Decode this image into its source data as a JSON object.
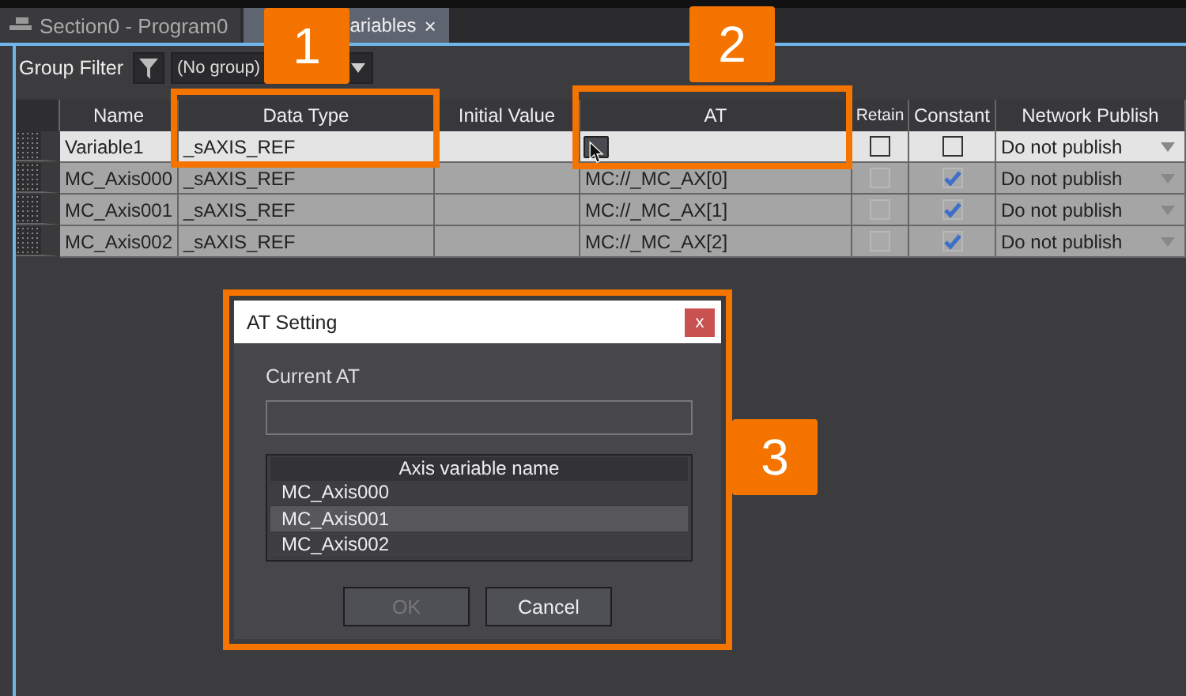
{
  "tabs": [
    {
      "label": "Section0 - Program0",
      "selected": false
    },
    {
      "label": "ariables",
      "selected": true,
      "close": "×"
    }
  ],
  "toolbar": {
    "label": "Group Filter",
    "group": "(No group)"
  },
  "table": {
    "columns": [
      "Name",
      "Data Type",
      "Initial Value",
      "AT",
      "Retain",
      "Constant",
      "Network Publish"
    ],
    "rows": [
      {
        "name": "Variable1",
        "data_type": "_sAXIS_REF",
        "at": "",
        "retain": false,
        "constant": false,
        "publish": "Do not publish",
        "selected": true,
        "read_only": false
      },
      {
        "name": "MC_Axis000",
        "data_type": "_sAXIS_REF",
        "at": "MC://_MC_AX[0]",
        "retain": false,
        "constant": true,
        "publish": "Do not publish",
        "selected": false,
        "read_only": true
      },
      {
        "name": "MC_Axis001",
        "data_type": "_sAXIS_REF",
        "at": "MC://_MC_AX[1]",
        "retain": false,
        "constant": true,
        "publish": "Do not publish",
        "selected": false,
        "read_only": true
      },
      {
        "name": "MC_Axis002",
        "data_type": "_sAXIS_REF",
        "at": "MC://_MC_AX[2]",
        "retain": false,
        "constant": true,
        "publish": "Do not publish",
        "selected": false,
        "read_only": true
      }
    ]
  },
  "dialog": {
    "title": "AT Setting",
    "close": "x",
    "field_label": "Current AT",
    "list_header": "Axis variable name",
    "items": [
      {
        "label": "MC_Axis000",
        "selected": false
      },
      {
        "label": "MC_Axis001",
        "selected": true
      },
      {
        "label": "MC_Axis002",
        "selected": false
      }
    ],
    "buttons": [
      {
        "label": "OK",
        "disabled": true
      },
      {
        "label": "Cancel",
        "disabled": false
      }
    ]
  },
  "callouts": [
    "1",
    "2",
    "3"
  ]
}
